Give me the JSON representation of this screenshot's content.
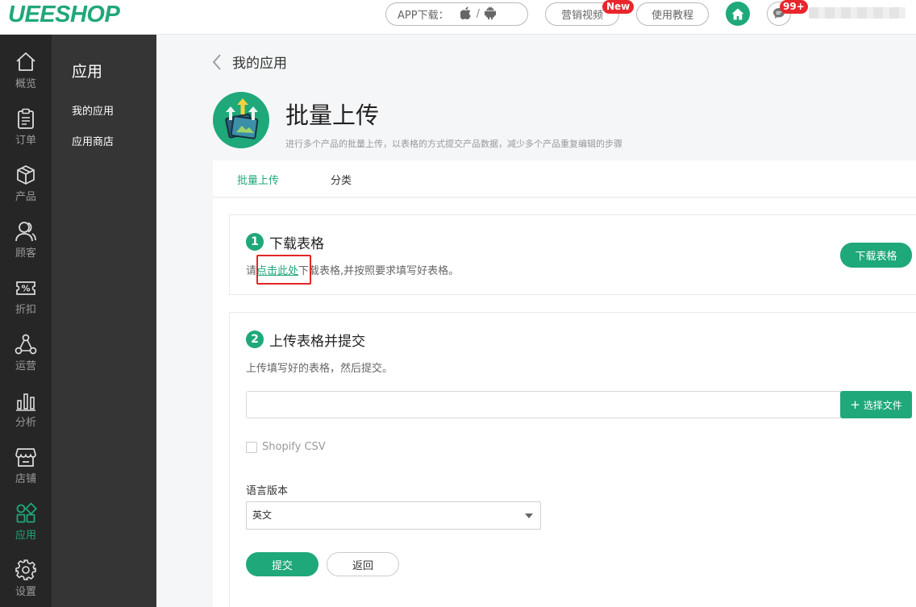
{
  "topbar": {
    "logo": "UEESHOP",
    "app_download_label": "APP下载：",
    "app_download_sep": "/",
    "marketing_video": "营销视频",
    "new_badge": "New",
    "tutorial": "使用教程",
    "message_count": "99+"
  },
  "rail": {
    "items": [
      {
        "label": "概览",
        "icon": "home-icon"
      },
      {
        "label": "订单",
        "icon": "clipboard-icon"
      },
      {
        "label": "产品",
        "icon": "box-icon"
      },
      {
        "label": "顾客",
        "icon": "users-icon"
      },
      {
        "label": "折扣",
        "icon": "discount-icon"
      },
      {
        "label": "运营",
        "icon": "network-icon"
      },
      {
        "label": "分析",
        "icon": "bar-chart-icon"
      },
      {
        "label": "店铺",
        "icon": "store-icon"
      },
      {
        "label": "应用",
        "icon": "apps-icon"
      },
      {
        "label": "设置",
        "icon": "gear-icon"
      }
    ],
    "active_index": 8
  },
  "subnav": {
    "title": "应用",
    "links": [
      "我的应用",
      "应用商店"
    ]
  },
  "breadcrumb": "我的应用",
  "app": {
    "title": "批量上传",
    "description": "进行多个产品的批量上传，以表格的方式提交产品数据，减少多个产品重复编辑的步骤"
  },
  "tabs": [
    "批量上传",
    "分类"
  ],
  "step1": {
    "number": "1",
    "title": "下载表格",
    "hint_before": "请",
    "hint_link": "点击此处",
    "hint_after": "下载表格,并按照要求填写好表格。",
    "button": "下载表格"
  },
  "step2": {
    "number": "2",
    "title": "上传表格并提交",
    "hint": "上传填写好的表格，然后提交。",
    "file_placeholder": "",
    "choose_file": "选择文件",
    "checkbox_label": "Shopify CSV",
    "language_label": "语言版本",
    "language_value": "英文",
    "submit": "提交",
    "back": "返回"
  },
  "colors": {
    "accent": "#1fa879",
    "badge": "#e8262b",
    "rail_bg": "#262626",
    "subnav_bg": "#353535",
    "highlight_box": "#e32525"
  }
}
